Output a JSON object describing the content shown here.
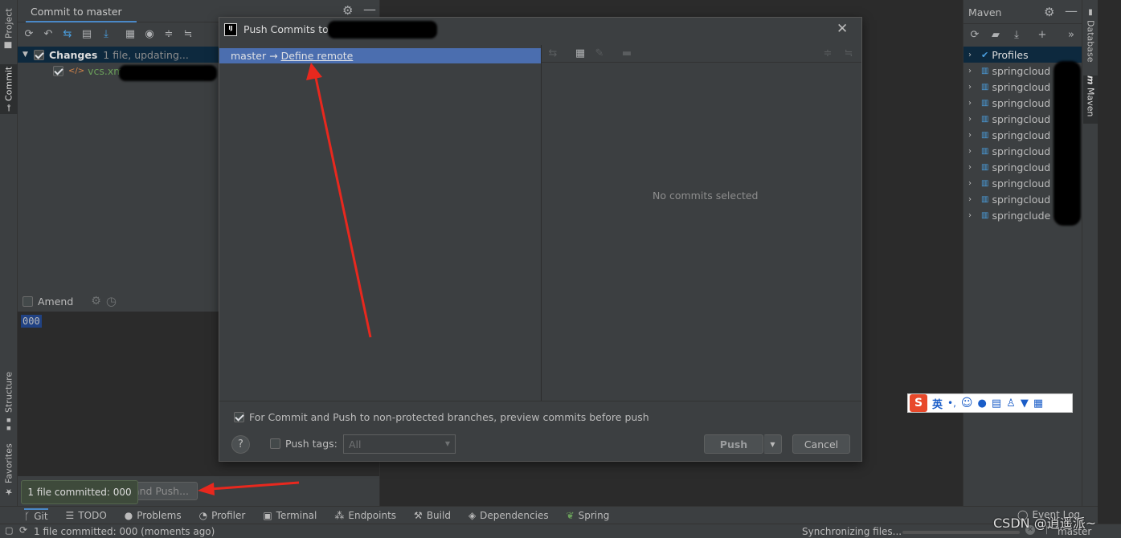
{
  "left_tabs": {
    "project": "Project",
    "commit": "Commit",
    "structure": "Structure",
    "favorites": "Favorites"
  },
  "right_tabs": {
    "database": "Database",
    "maven": "Maven"
  },
  "commit_panel": {
    "title": "Commit to master",
    "changes_label": "Changes",
    "changes_info": "1 file, updating...",
    "file_name": "vcs.xml",
    "amend_label": "Amend",
    "message": "000",
    "commit_push_label": "and Push...",
    "toast": "1 file committed: 000"
  },
  "dialog": {
    "title": "Push Commits to",
    "branch": "master",
    "arrow": "→",
    "define_remote": "Define remote",
    "no_commits": "No commits selected",
    "preview_checkbox": "For Commit and Push to non-protected branches, preview commits before push",
    "push_tags_label": "Push tags:",
    "push_tags_value": "All",
    "push_button": "Push",
    "cancel_button": "Cancel",
    "help": "?"
  },
  "maven": {
    "title": "Maven",
    "profiles": "Profiles",
    "items": [
      "springcloud",
      "springcloud",
      "springcloud",
      "springcloud",
      "springcloud",
      "springcloud",
      "springcloud",
      "springcloud",
      "springcloud",
      "springclude"
    ]
  },
  "bottom_toolbar": {
    "git": "Git",
    "todo": "TODO",
    "problems": "Problems",
    "profiler": "Profiler",
    "terminal": "Terminal",
    "endpoints": "Endpoints",
    "build": "Build",
    "dependencies": "Dependencies",
    "spring": "Spring",
    "event_log": "Event Log"
  },
  "status_bar": {
    "message": "1 file committed: 000 (moments ago)",
    "sync": "Synchronizing files...",
    "branch": "master"
  },
  "ime": {
    "lang": "英",
    "punct": "•,"
  },
  "watermark": "CSDN @逍遥派~",
  "colors": {
    "accent": "#4b6eaf",
    "selection": "#2f65ca",
    "annotation": "#e8281e"
  }
}
